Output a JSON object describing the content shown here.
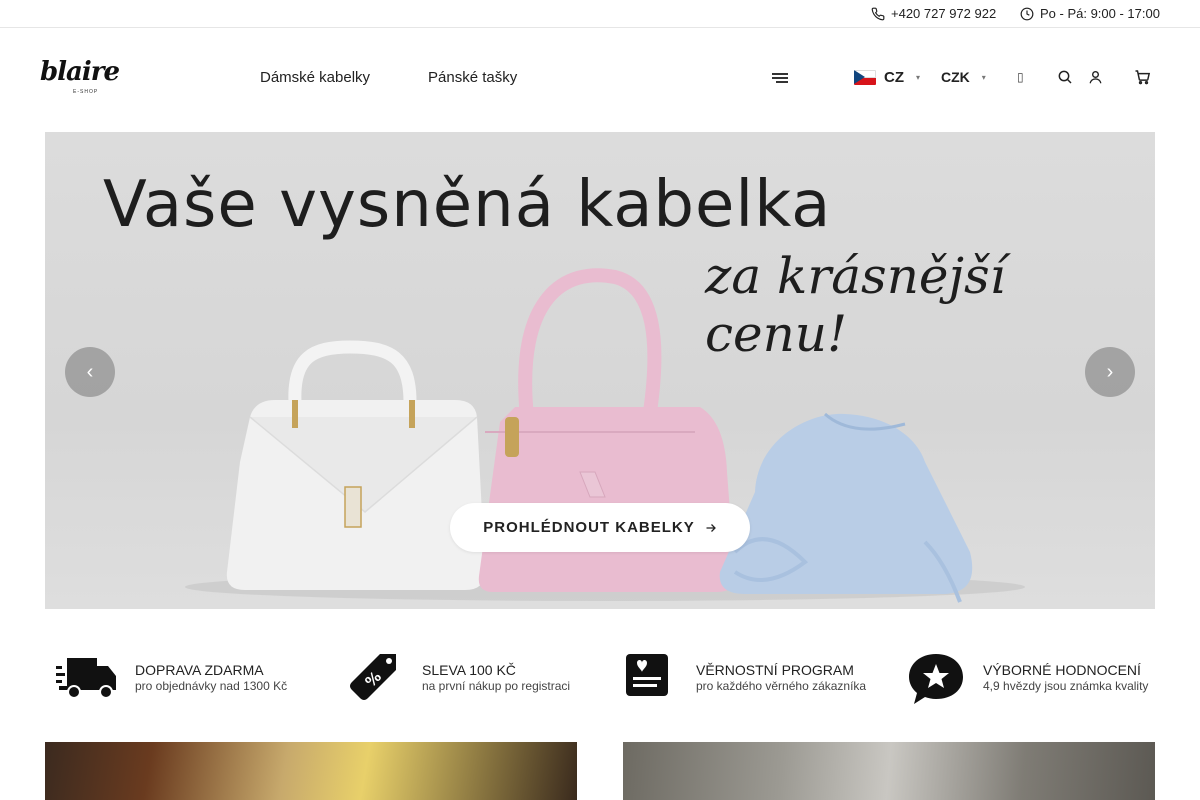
{
  "topbar": {
    "phone": "+420 727 972 922",
    "hours": "Po - Pá: 9:00 - 17:00"
  },
  "header": {
    "logo_text": "blaire",
    "logo_sub": "E-SHOP",
    "nav": [
      "Dámské kabelky",
      "Pánské tašky"
    ],
    "language": "CZ",
    "currency": "CZK",
    "icons": [
      "menu-icon",
      "search-icon",
      "user-icon",
      "cart-icon"
    ]
  },
  "hero": {
    "title": "Vaše vysněná kabelka",
    "subtitle": "za krásnější cenu!",
    "cta_label": "PROHLÉDNOUT KABELKY",
    "prev_icon": "chevron-left-icon",
    "next_icon": "chevron-right-icon"
  },
  "features": [
    {
      "icon": "truck-icon",
      "title": "DOPRAVA ZDARMA",
      "desc": "pro objednávky nad 1300 Kč"
    },
    {
      "icon": "discount-tag-icon",
      "title": "SLEVA 100 KČ",
      "desc": "na první nákup po registraci"
    },
    {
      "icon": "loyalty-card-icon",
      "title": "VĚRNOSTNÍ PROGRAM",
      "desc": "pro každého věrného zákazníka"
    },
    {
      "icon": "star-bubble-icon",
      "title": "VÝBORNÉ HODNOCENÍ",
      "desc": "4,9 hvězdy jsou známka kvality"
    }
  ],
  "colors": {
    "accent": "#222222",
    "hero_bg": "#d8d8d8",
    "bag_white": "#f2f2f2",
    "bag_pink": "#e9bcd0",
    "bag_blue": "#b9cde6",
    "flag_red": "#d7141a",
    "flag_blue": "#11457e"
  }
}
